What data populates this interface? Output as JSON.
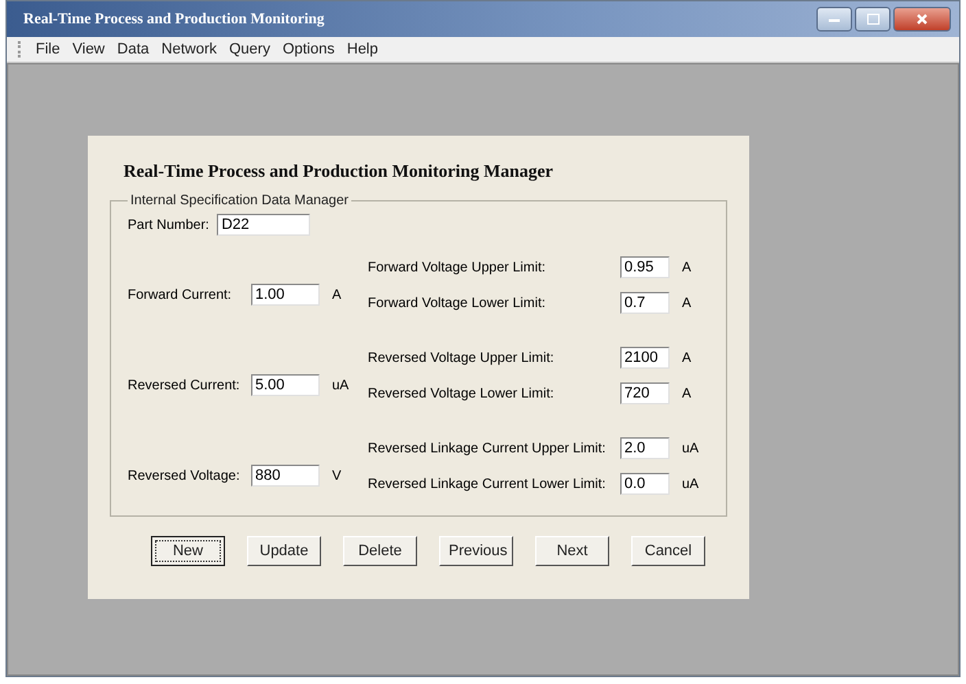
{
  "window": {
    "title": "Real-Time Process and Production Monitoring"
  },
  "menu": [
    "File",
    "View",
    "Data",
    "Network",
    "Query",
    "Options",
    "Help"
  ],
  "dialog": {
    "heading": "Real-Time Process and Production Monitoring Manager",
    "group_title": "Internal Specification Data Manager",
    "part_number": {
      "label": "Part Number:",
      "value": "D22"
    },
    "left_fields": [
      {
        "label": "Forward Current:",
        "value": "1.00",
        "unit": "A"
      },
      {
        "label": "Reversed Current:",
        "value": "5.00",
        "unit": "uA"
      },
      {
        "label": "Reversed Voltage:",
        "value": "880",
        "unit": "V"
      }
    ],
    "right_fields": [
      {
        "label": "Forward Voltage Upper Limit:",
        "value": "0.95",
        "unit": "A"
      },
      {
        "label": "Forward Voltage Lower Limit:",
        "value": "0.7",
        "unit": "A"
      },
      {
        "label": "Reversed Voltage Upper Limit:",
        "value": "2100",
        "unit": "A"
      },
      {
        "label": "Reversed Voltage Lower Limit:",
        "value": "720",
        "unit": "A"
      },
      {
        "label": "Reversed Linkage Current Upper Limit:",
        "value": "2.0",
        "unit": "uA"
      },
      {
        "label": "Reversed Linkage Current Lower Limit:",
        "value": "0.0",
        "unit": "uA"
      }
    ],
    "buttons": [
      {
        "label": "New",
        "focused": true
      },
      {
        "label": "Update",
        "focused": false
      },
      {
        "label": "Delete",
        "focused": false
      },
      {
        "label": "Previous",
        "focused": false
      },
      {
        "label": "Next",
        "focused": false
      },
      {
        "label": "Cancel",
        "focused": false
      }
    ]
  }
}
